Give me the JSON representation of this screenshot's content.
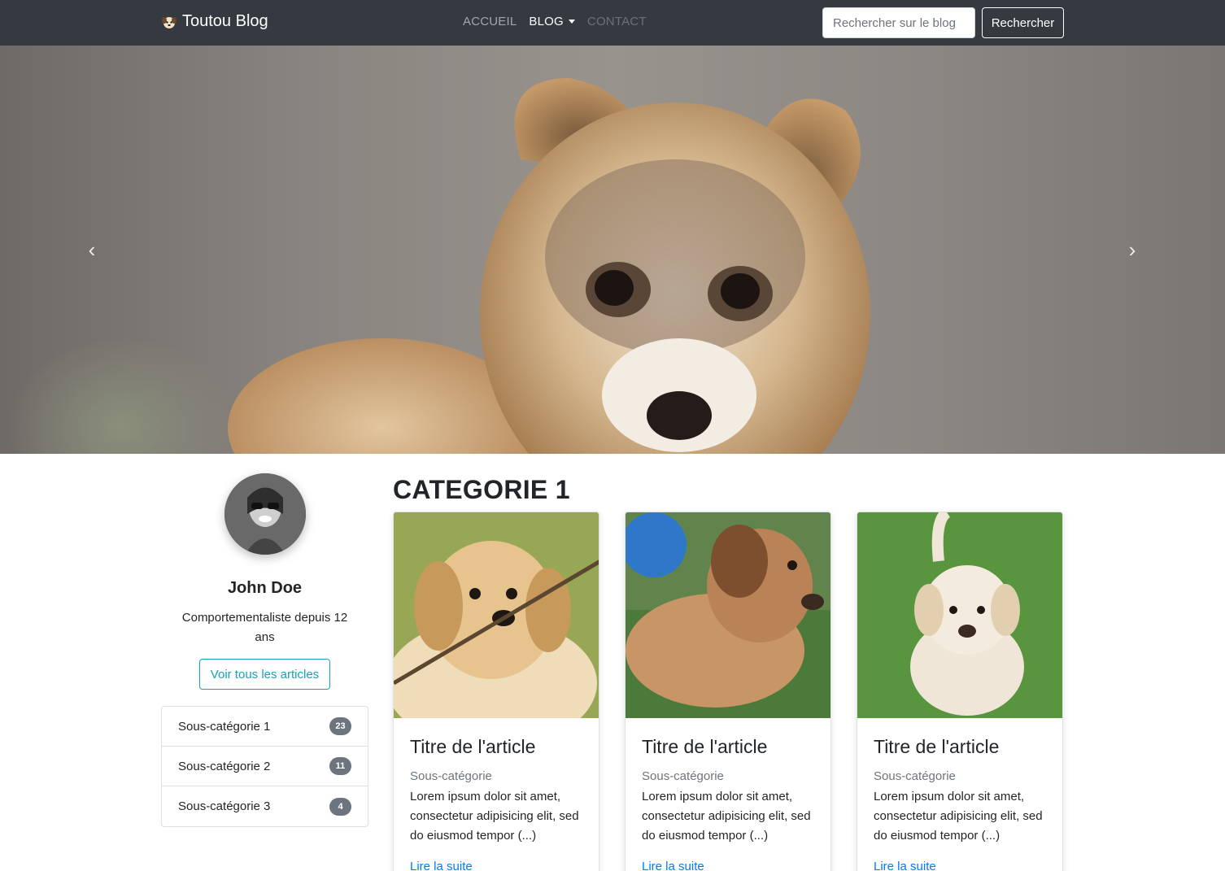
{
  "navbar": {
    "brand": "Toutou Blog",
    "brand_icon": "dog-face-icon",
    "links": [
      {
        "label": "ACCUEIL"
      },
      {
        "label": "BLOG"
      },
      {
        "label": "CONTACT"
      }
    ],
    "search_placeholder": "Rechercher sur le blog",
    "search_button": "Rechercher"
  },
  "carousel": {
    "prev_icon": "chevron-left-icon",
    "next_icon": "chevron-right-icon",
    "prev_glyph": "‹",
    "next_glyph": "›"
  },
  "author": {
    "name": "John Doe",
    "bio": "Comportementaliste depuis 12 ans",
    "button": "Voir tous les articles"
  },
  "subcategories": [
    {
      "label": "Sous-catégorie 1",
      "count": "23"
    },
    {
      "label": "Sous-catégorie 2",
      "count": "11"
    },
    {
      "label": "Sous-catégorie 3",
      "count": "4"
    }
  ],
  "main": {
    "title": "CATEGORIE 1",
    "cards": [
      {
        "title": "Titre de l'article",
        "subtitle": "Sous-catégorie",
        "text": "Lorem ipsum dolor sit amet, consectetur adipisicing elit, sed do eiusmod tempor (...)",
        "link": "Lire la suite"
      },
      {
        "title": "Titre de l'article",
        "subtitle": "Sous-catégorie",
        "text": "Lorem ipsum dolor sit amet, consectetur adipisicing elit, sed do eiusmod tempor (...)",
        "link": "Lire la suite"
      },
      {
        "title": "Titre de l'article",
        "subtitle": "Sous-catégorie",
        "text": "Lorem ipsum dolor sit amet, consectetur adipisicing elit, sed do eiusmod tempor (...)",
        "link": "Lire la suite"
      }
    ]
  },
  "colors": {
    "navbar_bg": "#343a40",
    "accent_info": "#17a2b8",
    "link": "#007bff",
    "badge": "#6c757d"
  }
}
